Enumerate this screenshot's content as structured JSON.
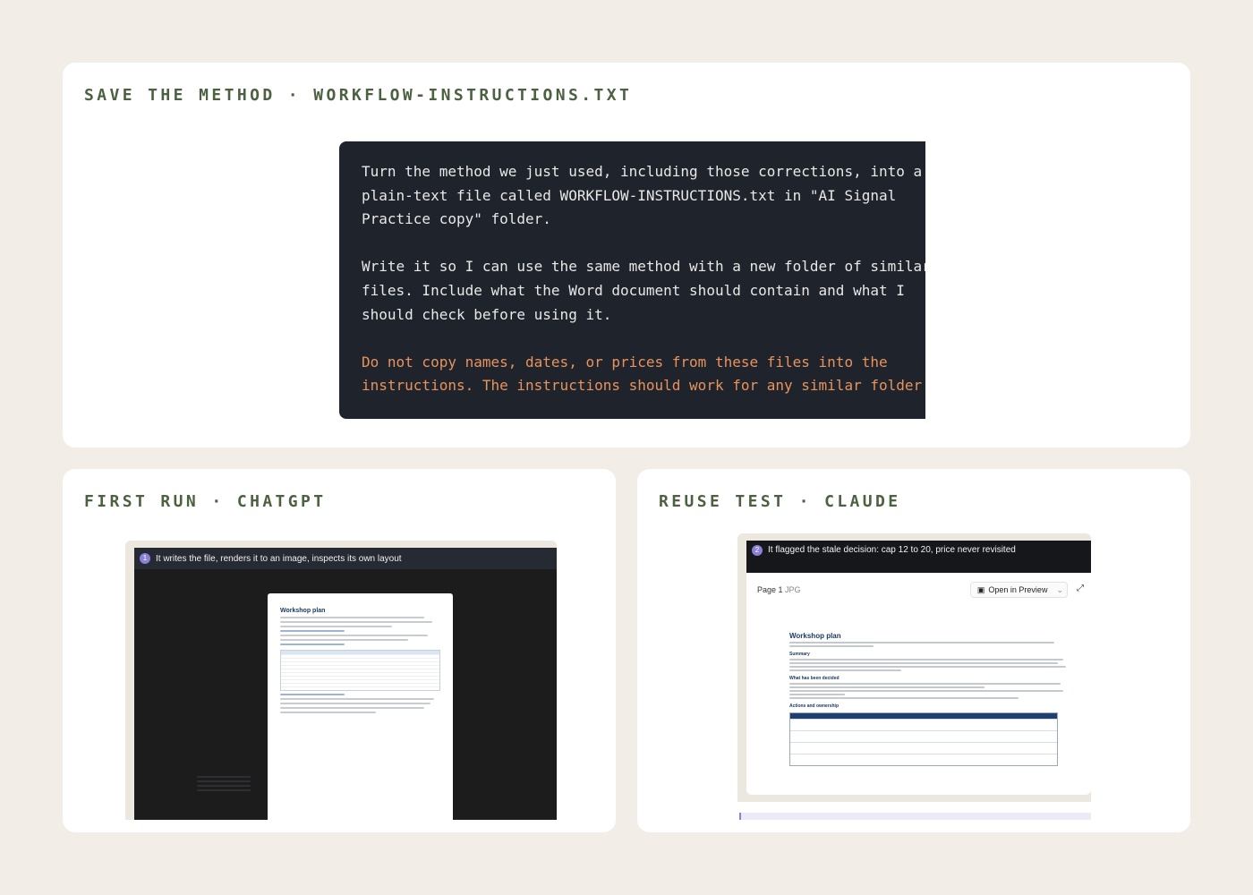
{
  "top_card": {
    "title": "SAVE THE METHOD · WORKFLOW-INSTRUCTIONS.TXT",
    "prompt_paragraph_1": "Turn the method we just used, including those corrections, into a\nplain-text file called WORKFLOW-INSTRUCTIONS.txt in \"AI Signal\nPractice copy\" folder.",
    "prompt_paragraph_2": "Write it so I can use the same method with a new folder of similar\nfiles. Include what the Word document should contain and what I\nshould check before using it.",
    "prompt_paragraph_3": "Do not copy names, dates, or prices from these files into the\ninstructions. The instructions should work for any similar folder."
  },
  "left_card": {
    "title": "FIRST RUN · CHATGPT",
    "caption_number": "1",
    "caption": "It writes the file, renders it to an image, inspects its own layout",
    "doc_title": "Workshop plan"
  },
  "right_card": {
    "title": "REUSE TEST · CLAUDE",
    "caption_number": "2",
    "caption": "It flagged the stale decision: cap 12 to 20, price never revisited",
    "preview_label": "Page 1",
    "preview_type": "JPG",
    "open_button": "Open in Preview",
    "doc_title": "Workshop plan",
    "sections": [
      "Summary",
      "What has been decided",
      "Actions and ownership"
    ]
  },
  "colors": {
    "background": "#f2eee7",
    "title": "#4c6141",
    "prompt_bg": "#1f232b",
    "prompt_warn": "#e8935e",
    "accent": "#8b7fd8"
  }
}
